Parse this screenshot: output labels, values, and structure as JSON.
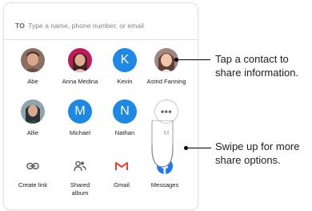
{
  "share_sheet": {
    "to_label": "TO",
    "to_placeholder": "Type a name, phone number, or email",
    "contacts": [
      {
        "name": "Abe",
        "type": "photo"
      },
      {
        "name": "Anna Medina",
        "type": "photo"
      },
      {
        "name": "Kevin",
        "type": "letter",
        "letter": "K"
      },
      {
        "name": "Astrid Fanning",
        "type": "photo"
      },
      {
        "name": "Allie",
        "type": "photo"
      },
      {
        "name": "Michael",
        "type": "letter",
        "letter": "M"
      },
      {
        "name": "Nathan",
        "type": "letter",
        "letter": "N"
      },
      {
        "name": "M",
        "type": "more",
        "glyph": "•••"
      }
    ],
    "apps": [
      {
        "name": "Create link",
        "icon": "link-icon"
      },
      {
        "name": "Shared album",
        "icon": "shared-album-icon"
      },
      {
        "name": "Gmail",
        "icon": "gmail-icon"
      },
      {
        "name": "Messages",
        "icon": "facebook-icon"
      }
    ]
  },
  "callouts": {
    "contact": "Tap a contact to share information.",
    "swipe": "Swipe up for more share options."
  },
  "colors": {
    "letter_avatar": "#1e88e5",
    "facebook": "#1877f2",
    "gmail_red": "#ea4335"
  }
}
